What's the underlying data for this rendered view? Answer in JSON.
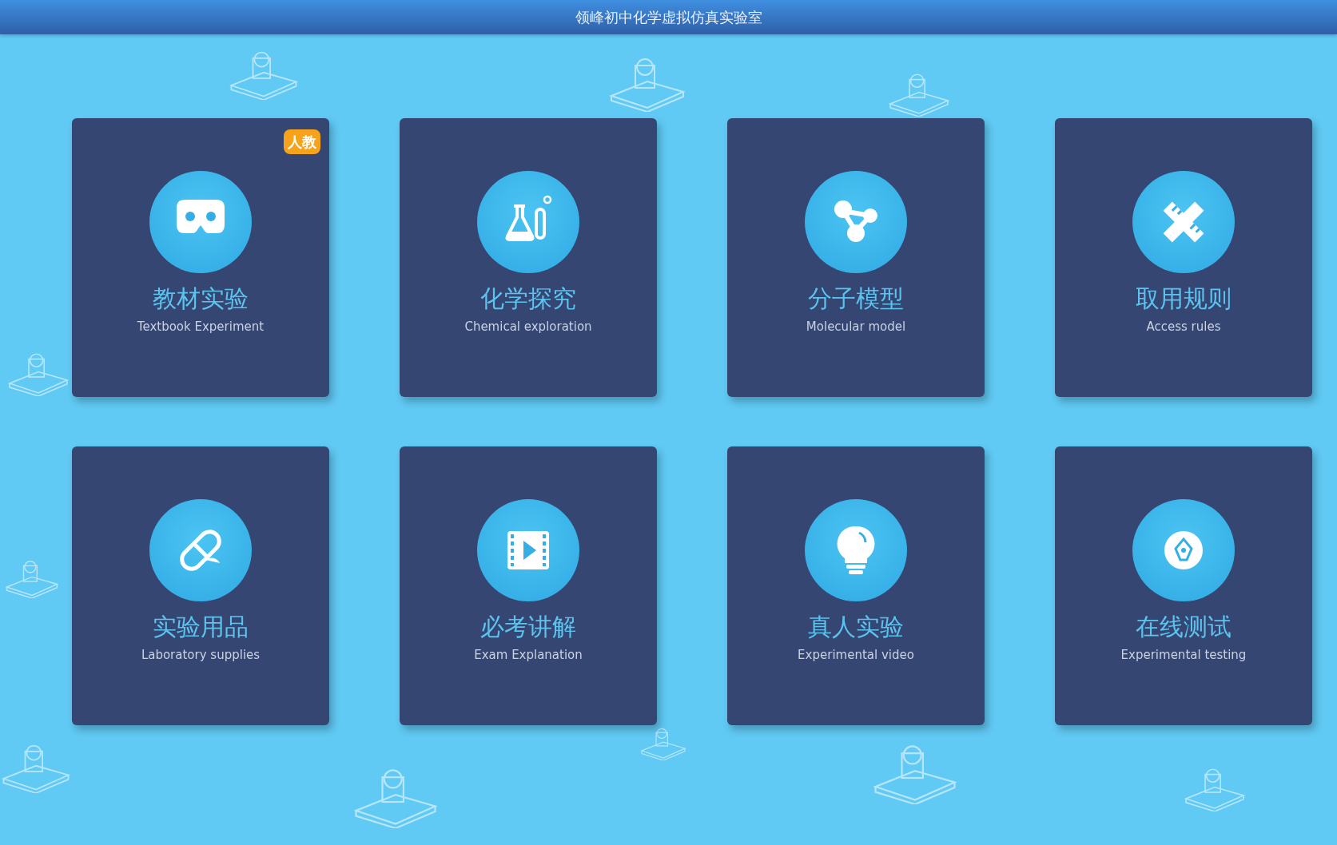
{
  "window": {
    "title": "领峰初中化学虚拟仿真实验室"
  },
  "cards": [
    {
      "title": "教材实验",
      "subtitle": "Textbook Experiment",
      "badge": "人教"
    },
    {
      "title": "化学探究",
      "subtitle": "Chemical exploration"
    },
    {
      "title": "分子模型",
      "subtitle": "Molecular model"
    },
    {
      "title": "取用规则",
      "subtitle": "Access rules"
    },
    {
      "title": "实验用品",
      "subtitle": "Laboratory supplies"
    },
    {
      "title": "必考讲解",
      "subtitle": "Exam Explanation"
    },
    {
      "title": "真人实验",
      "subtitle": "Experimental video"
    },
    {
      "title": "在线测试",
      "subtitle": "Experimental testing"
    }
  ]
}
